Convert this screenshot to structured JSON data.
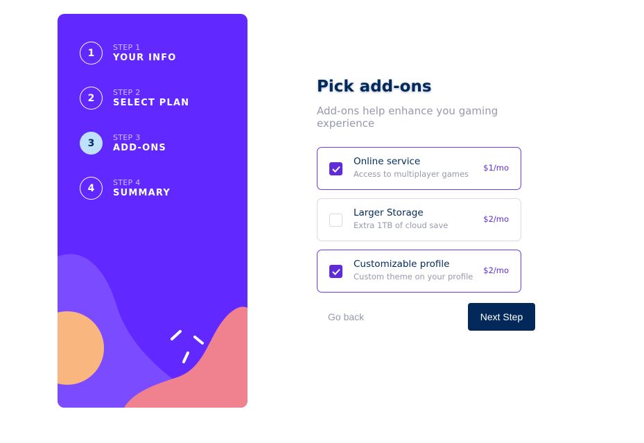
{
  "sidebar": {
    "steps": [
      {
        "number": "1",
        "caption": "STEP 1",
        "title": "YOUR INFO",
        "active": false
      },
      {
        "number": "2",
        "caption": "STEP 2",
        "title": "SELECT PLAN",
        "active": false
      },
      {
        "number": "3",
        "caption": "STEP 3",
        "title": "ADD-ONS",
        "active": true
      },
      {
        "number": "4",
        "caption": "STEP 4",
        "title": "SUMMARY",
        "active": false
      }
    ]
  },
  "main": {
    "title": "Pick add-ons",
    "subtitle": "Add-ons help enhance you gaming experience",
    "addons": [
      {
        "name": "Online service",
        "description": "Access to multiplayer games",
        "price": "$1/mo",
        "checked": true
      },
      {
        "name": "Larger Storage",
        "description": "Extra 1TB of cloud save",
        "price": "$2/mo",
        "checked": false
      },
      {
        "name": "Customizable profile",
        "description": "Custom theme on your profile",
        "price": "$2/mo",
        "checked": true
      }
    ]
  },
  "nav": {
    "back_label": "Go back",
    "next_label": "Next Step"
  },
  "colors": {
    "sidebar_bg": "#6128ff",
    "marine_blue": "#02295a",
    "purplish_blue": "#5f2cd8",
    "light_blue": "#bee2fd",
    "cool_gray": "#9699ab",
    "orange_blob": "#f9b77f",
    "pink_blob": "#f0818f",
    "violet_blob": "#7b4bff"
  }
}
